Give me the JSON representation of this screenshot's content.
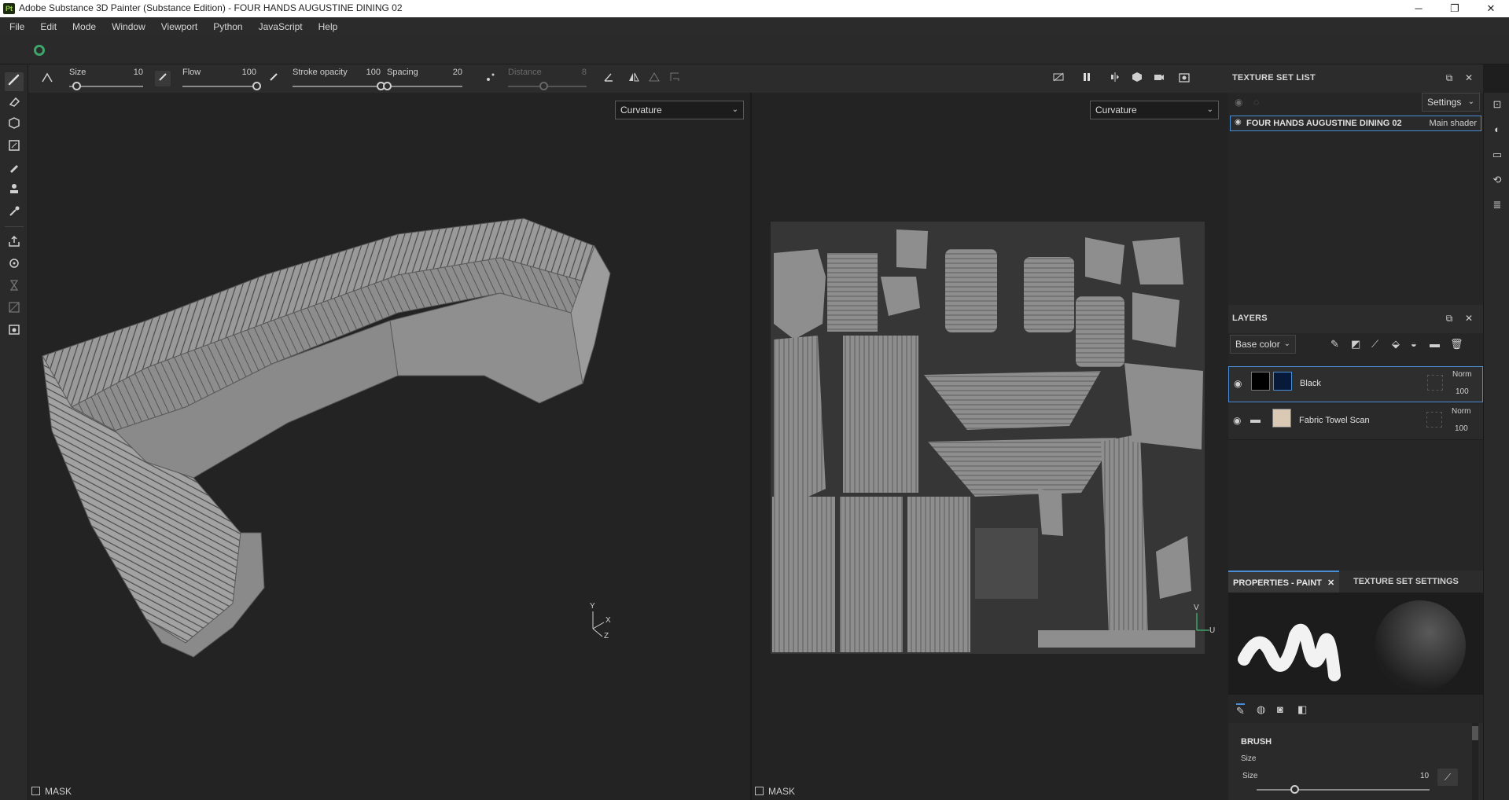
{
  "window": {
    "logo": "Pt",
    "title": "Adobe Substance 3D Painter (Substance Edition) - FOUR HANDS AUGUSTINE DINING 02",
    "minimize": "─",
    "maximize": "❐",
    "close": "✕"
  },
  "menu": [
    "File",
    "Edit",
    "Mode",
    "Window",
    "Viewport",
    "Python",
    "JavaScript",
    "Help"
  ],
  "brush_toolbar": {
    "size": {
      "label": "Size",
      "value": "10",
      "fraction": 0.1
    },
    "flow": {
      "label": "Flow",
      "value": "100",
      "fraction": 1.0
    },
    "stroke_opacity": {
      "label": "Stroke opacity",
      "value": "100",
      "fraction": 1.0
    },
    "spacing": {
      "label": "Spacing",
      "value": "20",
      "fraction": 0.0
    },
    "distance": {
      "label": "Distance",
      "value": "8",
      "fraction": 0.45
    }
  },
  "viewport_3d": {
    "channel": "Curvature",
    "mask_label": "MASK",
    "gizmo": {
      "y": "Y",
      "x": "X",
      "z": "Z"
    }
  },
  "viewport_2d": {
    "channel": "Curvature",
    "mask_label": "MASK",
    "gizmo": {
      "v": "V",
      "u": "U"
    }
  },
  "texture_set_list": {
    "title": "TEXTURE SET LIST",
    "settings_label": "Settings",
    "item_name": "FOUR HANDS AUGUSTINE DINING 02",
    "item_shader": "Main shader"
  },
  "layers": {
    "title": "LAYERS",
    "channel": "Base color",
    "rows": [
      {
        "name": "Black",
        "blend": "Norm",
        "opacity": "100",
        "selected": true
      },
      {
        "name": "Fabric Towel Scan",
        "blend": "Norm",
        "opacity": "100",
        "selected": false
      }
    ]
  },
  "properties": {
    "tab_paint": "PROPERTIES - PAINT",
    "tab_tss": "TEXTURE SET SETTINGS",
    "brush_heading": "BRUSH",
    "size_group_label": "Size",
    "size_label": "Size",
    "size_value": "10",
    "size_fraction": 0.22
  },
  "colors": {
    "accent_blue": "#4a8fd6",
    "panel_bg": "#262626",
    "viewport_bg": "#232323"
  }
}
